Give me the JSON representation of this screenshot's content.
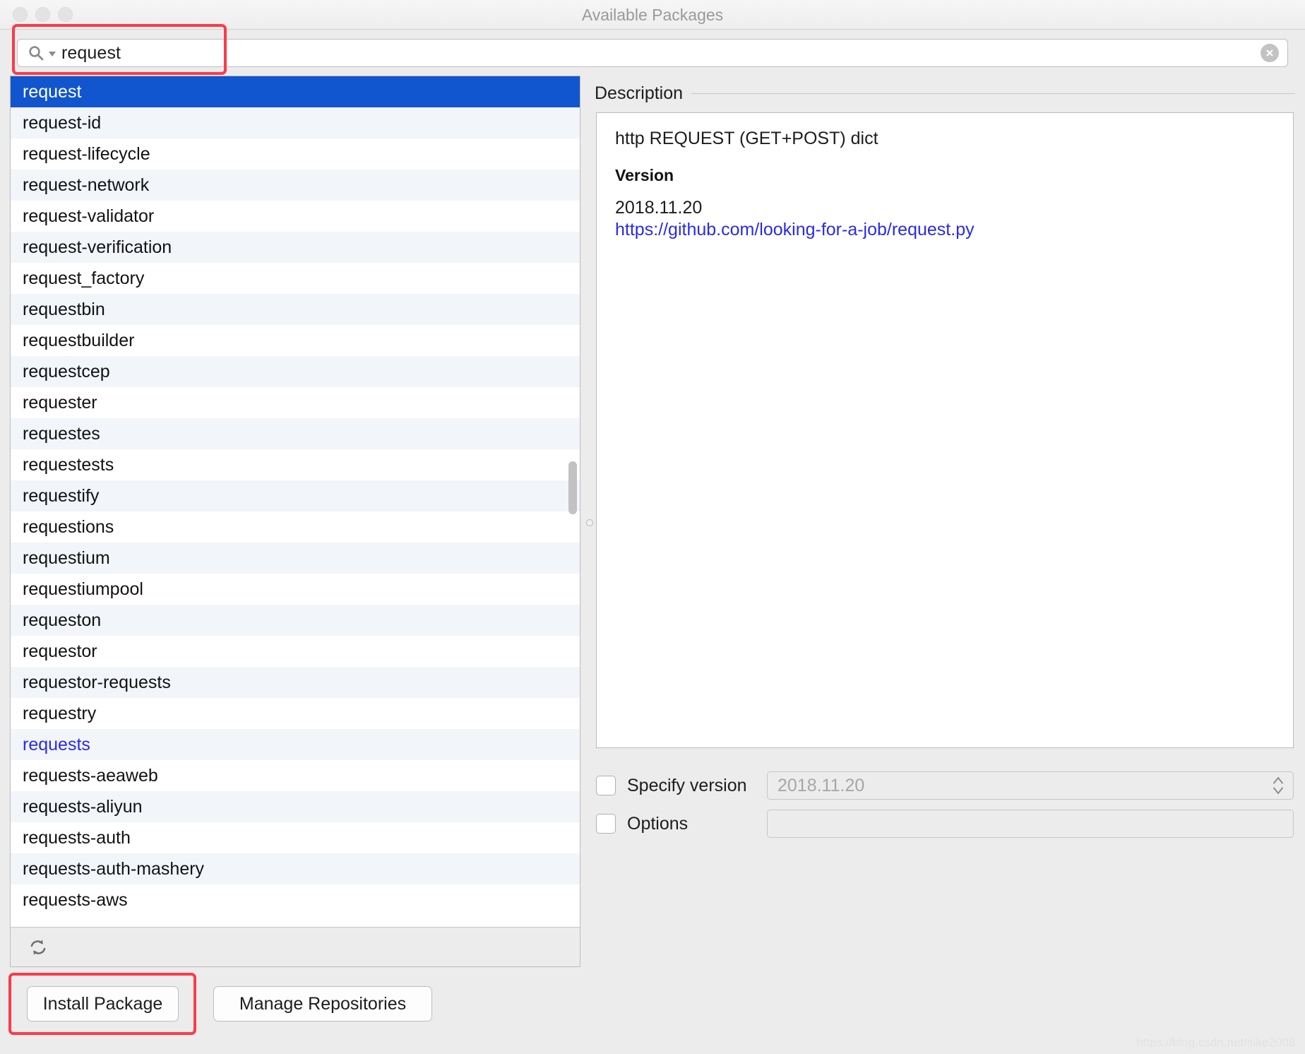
{
  "window": {
    "title": "Available Packages",
    "traffic_lights": [
      "close",
      "minimize",
      "zoom"
    ]
  },
  "search": {
    "value": "request",
    "placeholder": "",
    "icon": "search-icon",
    "dropdown_icon": "caret-down-icon",
    "clear_icon": "clear-circle-icon"
  },
  "package_list": {
    "selected": "request",
    "installed": [
      "requests"
    ],
    "items": [
      "request",
      "request-id",
      "request-lifecycle",
      "request-network",
      "request-validator",
      "request-verification",
      "request_factory",
      "requestbin",
      "requestbuilder",
      "requestcep",
      "requester",
      "requestes",
      "requestests",
      "requestify",
      "requestions",
      "requestium",
      "requestiumpool",
      "requeston",
      "requestor",
      "requestor-requests",
      "requestry",
      "requests",
      "requests-aeaweb",
      "requests-aliyun",
      "requests-auth",
      "requests-auth-mashery",
      "requests-aws"
    ],
    "footer": {
      "refresh_icon": "refresh-icon"
    }
  },
  "description": {
    "legend": "Description",
    "summary": "http REQUEST (GET+POST) dict",
    "version_heading": "Version",
    "version": "2018.11.20",
    "url": "https://github.com/looking-for-a-job/request.py"
  },
  "options": {
    "specify_version": {
      "label": "Specify version",
      "checked": false,
      "value": "2018.11.20"
    },
    "options_field": {
      "label": "Options",
      "checked": false,
      "value": ""
    }
  },
  "buttons": {
    "install": "Install Package",
    "manage": "Manage Repositories"
  },
  "watermark": "https://blog.csdn.net/sike2008",
  "colors": {
    "selection_blue": "#1155cf",
    "link_blue": "#2a2ae8",
    "annotation_red": "#fb3b4a",
    "row_alt": "#f2f5fa",
    "chrome": "#ececec"
  }
}
